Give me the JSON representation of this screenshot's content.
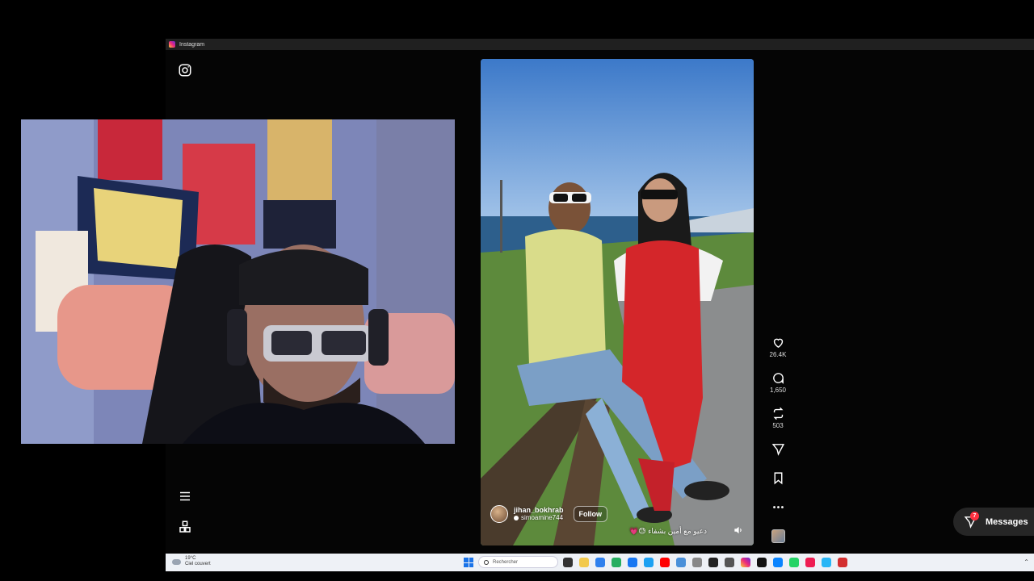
{
  "window": {
    "title": "Instagram"
  },
  "nav": {
    "top_icon": "instagram-icon",
    "menu_icon": "hamburger-menu-icon",
    "more_icon": "apps-grid-icon"
  },
  "reel": {
    "username": "jihan_bokhrab",
    "collaborator": "simoamine744",
    "follow_label": "Follow",
    "caption": "دعيو مع أمين بشفاء 😓💗"
  },
  "actions": {
    "likes": "26.4K",
    "comments": "1,650",
    "reposts": "503"
  },
  "messages": {
    "label": "Messages",
    "badge": "7"
  },
  "taskbar": {
    "weather_temp": "19°C",
    "weather_cond": "Ciel couvert",
    "search_placeholder": "Rechercher"
  },
  "colors": {
    "accent_badge": "#ff3040",
    "app_bg": "#050505",
    "taskbar_bg": "#eef1f6"
  }
}
